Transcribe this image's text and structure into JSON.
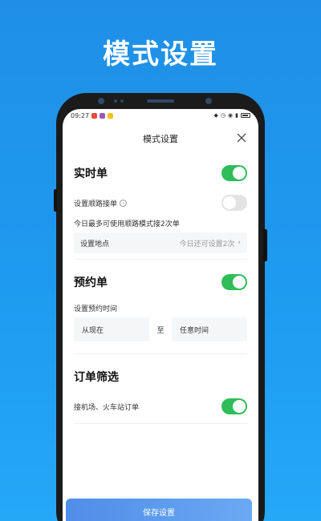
{
  "hero": {
    "title": "模式设置"
  },
  "status_bar": {
    "time": "09:27"
  },
  "header": {
    "title": "模式设置"
  },
  "realtime": {
    "title": "实时单",
    "enabled": true,
    "route_label": "设置顺路接单",
    "route_enabled": false,
    "note": "今日最多可使用顺路模式接2次单",
    "location_label": "设置地点",
    "location_hint": "今日还可设置2次"
  },
  "reservation": {
    "title": "预约单",
    "enabled": true,
    "time_label": "设置预约时间",
    "from": "从现在",
    "sep": "至",
    "to": "任意时间"
  },
  "filter": {
    "title": "订单筛选",
    "airport_label": "接机场、火车站订单",
    "airport_enabled": true
  },
  "footer": {
    "save_label": "保存设置"
  },
  "colors": {
    "toggle_on": "#2ebd59",
    "accent_blue": "#1e9bf0"
  }
}
